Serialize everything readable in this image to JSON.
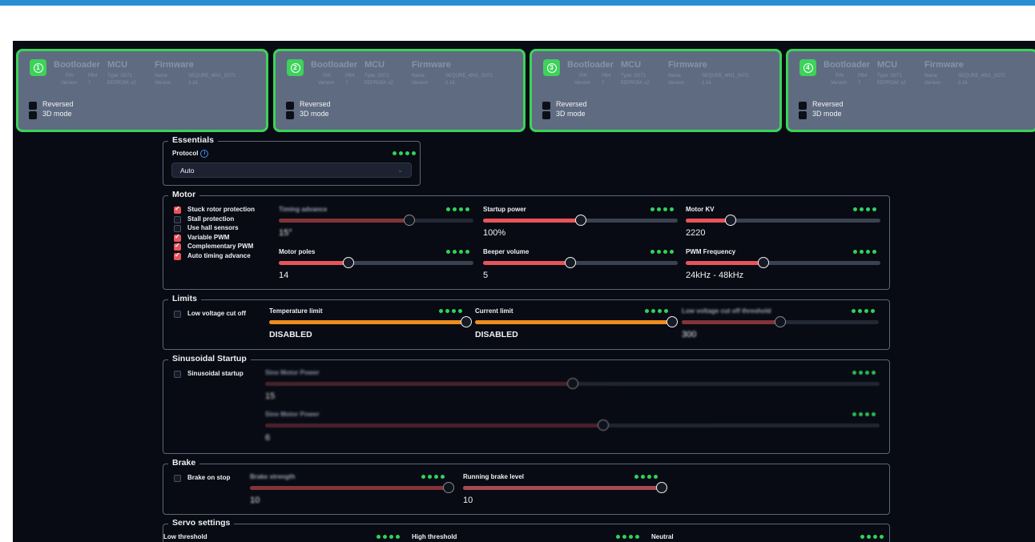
{
  "esc_cards": [
    {
      "badge": "1",
      "bootloader": "Bootloader",
      "mcu": "MCU",
      "firmware": "Firmware",
      "pin_label": "PIN",
      "pin": "PB4",
      "version_label": "Version",
      "bl_version": "7",
      "type": "Type: G071",
      "eeprom": "EEPROM: v2",
      "name_label": "Name",
      "name": "SEQURE_4IN1_G071",
      "fw_version_label": "Version",
      "fw_version": "2.16",
      "reversed": "Reversed",
      "mode3d": "3D mode"
    },
    {
      "badge": "2",
      "bootloader": "Bootloader",
      "mcu": "MCU",
      "firmware": "Firmware",
      "pin_label": "PIN",
      "pin": "PB4",
      "version_label": "Version",
      "bl_version": "7",
      "type": "Type: G071",
      "eeprom": "EEPROM: v2",
      "name_label": "Name",
      "name": "SEQURE_4IN1_G071",
      "fw_version_label": "Version",
      "fw_version": "2.16",
      "reversed": "Reversed",
      "mode3d": "3D mode"
    },
    {
      "badge": "3",
      "bootloader": "Bootloader",
      "mcu": "MCU",
      "firmware": "Firmware",
      "pin_label": "PIN",
      "pin": "PB4",
      "version_label": "Version",
      "bl_version": "7",
      "type": "Type: G071",
      "eeprom": "EEPROM: v2",
      "name_label": "Name",
      "name": "SEQURE_4IN1_G071",
      "fw_version_label": "Version",
      "fw_version": "2.16",
      "reversed": "Reversed",
      "mode3d": "3D mode"
    },
    {
      "badge": "4",
      "bootloader": "Bootloader",
      "mcu": "MCU",
      "firmware": "Firmware",
      "pin_label": "PIN",
      "pin": "PB4",
      "version_label": "Version",
      "bl_version": "7",
      "type": "Type: G071",
      "eeprom": "EEPROM: v2",
      "name_label": "Name",
      "name": "SEQURE_4IN1_G071",
      "fw_version_label": "Version",
      "fw_version": "2.16",
      "reversed": "Reversed",
      "mode3d": "3D mode"
    }
  ],
  "essentials": {
    "legend": "Essentials",
    "protocol_label": "Protocol",
    "protocol_value": "Auto"
  },
  "motor": {
    "legend": "Motor",
    "checkboxes": [
      {
        "label": "Stuck rotor protection",
        "checked": true
      },
      {
        "label": "Stall protection",
        "checked": false
      },
      {
        "label": "Use hall sensors",
        "checked": false
      },
      {
        "label": "Variable PWM",
        "checked": true
      },
      {
        "label": "Complementary PWM",
        "checked": true
      },
      {
        "label": "Auto timing advance",
        "checked": true
      }
    ],
    "sliders": [
      {
        "label": "Timing advance",
        "value": "15°",
        "level": 0.67,
        "disabled": true
      },
      {
        "label": "Startup power",
        "value": "100%",
        "level": 0.5
      },
      {
        "label": "Motor KV",
        "value": "2220",
        "level": 0.23
      },
      {
        "label": "Motor poles",
        "value": "14",
        "level": 0.36
      },
      {
        "label": "Beeper volume",
        "value": "5",
        "level": 0.45
      },
      {
        "label": "PWM Frequency",
        "value": "24kHz - 48kHz",
        "level": 0.4
      }
    ]
  },
  "limits": {
    "legend": "Limits",
    "low_voltage_label": "Low voltage cut off",
    "sliders": [
      {
        "label": "Temperature limit",
        "value": "DISABLED",
        "level": 1.0
      },
      {
        "label": "Current limit",
        "value": "DISABLED",
        "level": 1.0
      },
      {
        "label": "Low voltage cut off threshold",
        "value": "300",
        "level": 0.5,
        "disabled": true
      }
    ]
  },
  "sinusoidal": {
    "legend": "Sinusoidal Startup",
    "checkbox_label": "Sinusoidal startup",
    "sliders": [
      {
        "label": "Sine Motor Power",
        "value": "15",
        "level": 0.5
      },
      {
        "label": "Sine Motor Power",
        "value": "6",
        "level": 0.55
      }
    ]
  },
  "brake": {
    "legend": "Brake",
    "checkbox_label": "Brake on stop",
    "sliders": [
      {
        "label": "Brake strength",
        "value": "10",
        "level": 1.0,
        "disabled": true
      },
      {
        "label": "Running brake level",
        "value": "10",
        "level": 1.0
      }
    ]
  },
  "servo": {
    "legend": "Servo settings",
    "low_threshold": "Low threshold",
    "high_threshold": "High threshold",
    "neutral": "Neutral"
  },
  "colors": {
    "accent_red": "#e8545a",
    "accent_orange": "#f08c1e",
    "dots_green": "#2fd35a",
    "card_border": "#3dd25a"
  }
}
